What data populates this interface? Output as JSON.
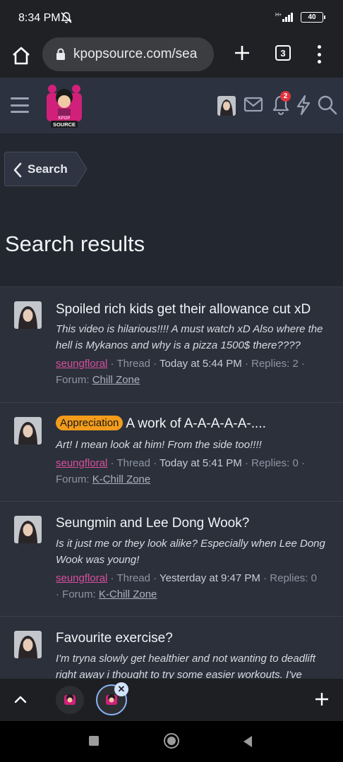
{
  "status_bar": {
    "time": "8:34 PM",
    "battery": "40"
  },
  "browser": {
    "url": "kpopsource.com/sea",
    "tab_count": "3"
  },
  "site_header": {
    "logo_text_top": "KPOP",
    "logo_text_bottom": "SOURCE",
    "notification_count": "2"
  },
  "breadcrumb": {
    "label": "Search"
  },
  "page": {
    "title": "Search results"
  },
  "results": [
    {
      "prefix": "",
      "title": "Spoiled rich kids get their allowance cut xD",
      "snippet": "This video is hilarious!!!! A must watch xD Also where the hell is Mykanos and why is a pizza 1500$ there????",
      "author": "seungfloral",
      "type": "Thread",
      "date": "Today at 5:44 PM",
      "replies": "Replies: 2",
      "forum_label": "Forum:",
      "forum": "Chill Zone"
    },
    {
      "prefix": "Appreciation",
      "title": "A work of A-A-A-A-A-....",
      "snippet": "Art! I mean look at him! From the side too!!!!",
      "author": "seungfloral",
      "type": "Thread",
      "date": "Today at 5:41 PM",
      "replies": "Replies: 0",
      "forum_label": "Forum:",
      "forum": "K-Chill Zone"
    },
    {
      "prefix": "",
      "title": "Seungmin and Lee Dong Wook?",
      "snippet": "Is it just me or they look alike? Especially when Lee Dong Wook was young!",
      "author": "seungfloral",
      "type": "Thread",
      "date": "Yesterday at 9:47 PM",
      "replies": "Replies: 0",
      "forum_label": "Forum:",
      "forum": "K-Chill Zone"
    },
    {
      "prefix": "",
      "title": "Favourite exercise?",
      "snippet": "I'm tryna slowly get healthier and not wanting to deadlift right away i thought to try some easier workouts. I've",
      "author": "",
      "type": "",
      "date": "",
      "replies": "",
      "forum_label": "",
      "forum": ""
    }
  ],
  "colors": {
    "accent_pink": "#d94f9c",
    "prefix_orange": "#f39c1b",
    "badge_red": "#e0343d",
    "header_bg": "#2c3240"
  },
  "icons": [
    "home-icon",
    "lock-icon",
    "plus-icon",
    "tabs-icon",
    "more-icon",
    "menu-icon",
    "mail-icon",
    "bell-icon",
    "bolt-icon",
    "search-icon",
    "chevron-left-icon",
    "chevron-up-icon",
    "close-icon"
  ]
}
